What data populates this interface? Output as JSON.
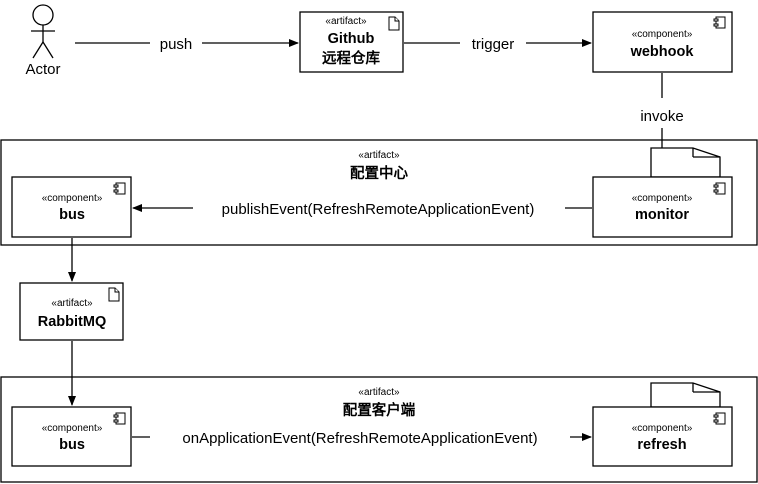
{
  "stereotypes": {
    "artifact": "«artifact»",
    "component": "«component»"
  },
  "actor": {
    "label": "Actor"
  },
  "nodes": {
    "github": {
      "line1": "Github",
      "line2": "远程仓库"
    },
    "webhook": {
      "name": "webhook"
    },
    "config_center": {
      "name": "配置中心"
    },
    "bus_center": {
      "name": "bus"
    },
    "monitor": {
      "name": "monitor"
    },
    "rabbitmq": {
      "name": "RabbitMQ"
    },
    "config_client": {
      "name": "配置客户端"
    },
    "bus_client": {
      "name": "bus"
    },
    "refresh": {
      "name": "refresh"
    }
  },
  "edges": {
    "push": "push",
    "trigger": "trigger",
    "invoke": "invoke",
    "publish": "publishEvent(RefreshRemoteApplicationEvent)",
    "on_app_event": "onApplicationEvent(RefreshRemoteApplicationEvent)"
  },
  "icons": {
    "artifact": "document-icon",
    "component": "component-icon",
    "actor": "stick-figure-icon"
  }
}
